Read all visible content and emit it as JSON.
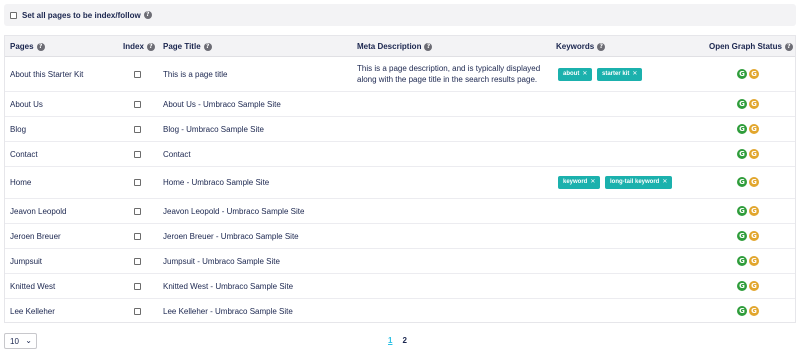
{
  "top": {
    "checkbox_label": "Set all pages to be index/follow"
  },
  "headers": {
    "pages": "Pages",
    "index": "Index",
    "page_title": "Page Title",
    "meta_description": "Meta Description",
    "keywords": "Keywords",
    "open_graph_status": "Open Graph Status"
  },
  "rows": [
    {
      "page": "About this Starter Kit",
      "title": "This is a page title",
      "description": "This is a page description, and is typically displayed along with the page title in the search results page.",
      "keywords": [
        "about",
        "starter kit"
      ]
    },
    {
      "page": "About Us",
      "title": "About Us - Umbraco Sample Site",
      "description": "",
      "keywords": []
    },
    {
      "page": "Blog",
      "title": "Blog - Umbraco Sample Site",
      "description": "",
      "keywords": []
    },
    {
      "page": "Contact",
      "title": "Contact",
      "description": "",
      "keywords": []
    },
    {
      "page": "Home",
      "title": "Home - Umbraco Sample Site",
      "description": "",
      "keywords": [
        "keyword",
        "long-tail keyword"
      ]
    },
    {
      "page": "Jeavon Leopold",
      "title": "Jeavon Leopold - Umbraco Sample Site",
      "description": "",
      "keywords": []
    },
    {
      "page": "Jeroen Breuer",
      "title": "Jeroen Breuer - Umbraco Sample Site",
      "description": "",
      "keywords": []
    },
    {
      "page": "Jumpsuit",
      "title": "Jumpsuit - Umbraco Sample Site",
      "description": "",
      "keywords": []
    },
    {
      "page": "Knitted West",
      "title": "Knitted West - Umbraco Sample Site",
      "description": "",
      "keywords": []
    },
    {
      "page": "Lee Kelleher",
      "title": "Lee Kelleher - Umbraco Sample Site",
      "description": "",
      "keywords": []
    }
  ],
  "og_badges": [
    "G",
    "G"
  ],
  "pagination": {
    "page_size": "10",
    "pages": [
      "1",
      "2"
    ],
    "current": "1"
  },
  "colors": {
    "keyword_tag": "#1bb1ad",
    "og_green": "#2f9d3b",
    "og_orange": "#e2a62d",
    "pager_active": "#2bc0e4"
  }
}
